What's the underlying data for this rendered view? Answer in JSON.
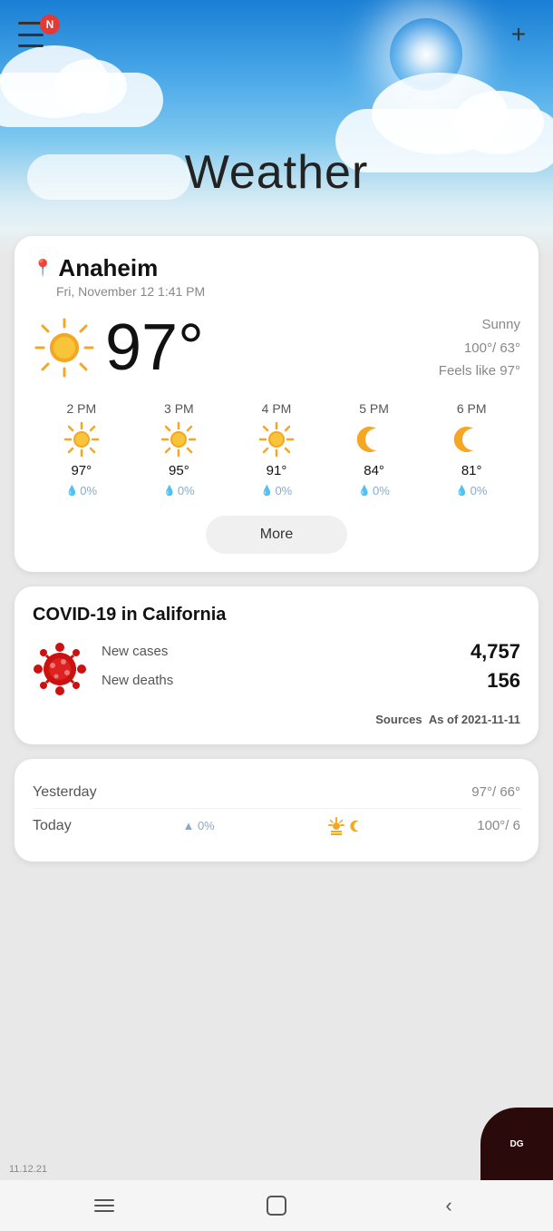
{
  "header": {
    "title": "Weather",
    "notification_badge": "N",
    "add_label": "+"
  },
  "weather_card": {
    "location": "Anaheim",
    "datetime": "Fri, November 12 1:41 PM",
    "current_temp": "97°",
    "condition": "Sunny",
    "high_low": "100°/ 63°",
    "feels_like": "Feels like 97°",
    "hourly": [
      {
        "time": "2 PM",
        "temp": "97°",
        "precip": "0%",
        "icon": "sun"
      },
      {
        "time": "3 PM",
        "temp": "95°",
        "precip": "0%",
        "icon": "sun"
      },
      {
        "time": "4 PM",
        "temp": "91°",
        "precip": "0%",
        "icon": "sun"
      },
      {
        "time": "5 PM",
        "temp": "84°",
        "precip": "0%",
        "icon": "moon"
      },
      {
        "time": "6 PM",
        "temp": "81°",
        "precip": "0%",
        "icon": "moon"
      }
    ],
    "more_button": "More"
  },
  "covid_card": {
    "title": "COVID-19 in California",
    "new_cases_label": "New cases",
    "new_cases_value": "4,757",
    "new_deaths_label": "New deaths",
    "new_deaths_value": "156",
    "source_label": "Sources",
    "source_date": "As of 2021-11-11"
  },
  "history_card": {
    "yesterday_label": "Yesterday",
    "yesterday_temps": "97°/ 66°",
    "today_label": "Today",
    "today_precip": "0%",
    "today_temps": "100°/ 6"
  },
  "bottom_date": "11.12.21"
}
